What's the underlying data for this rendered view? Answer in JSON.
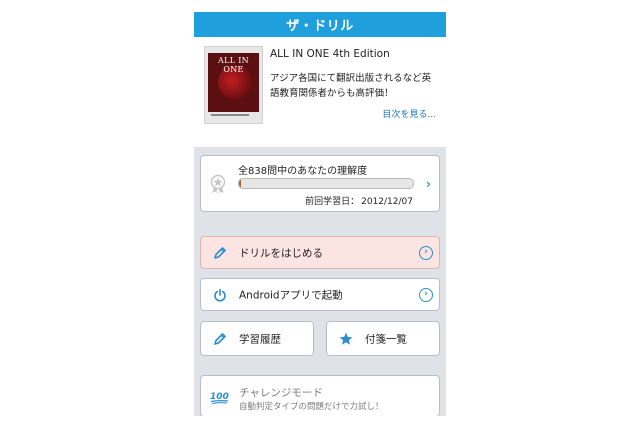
{
  "app": {
    "title": "ザ・ドリル"
  },
  "book": {
    "cover_title": "ALL IN ONE",
    "name": "ALL IN ONE 4th Edition",
    "description": "アジア各国にて翻訳出版されるなど英語教育関係者からも高評価！",
    "toc_link": "目次を見る..."
  },
  "progress": {
    "label": "全838問中のあなたの理解度",
    "fill": 0.01,
    "date_label": "前回学習日：",
    "date_value": "2012/12/07",
    "icon": "medal-icon"
  },
  "menu": {
    "start_label": "ドリルをはじめる",
    "android_label": "Androidアプリで起動",
    "history_label": "学習履歴",
    "sticky_label": "付箋一覧",
    "challenge_label": "チャレンジモード",
    "challenge_sub": "自動判定タイプの問題だけで力試し！"
  },
  "colors": {
    "title_bar": "#1fa0dc",
    "accent": "#2a8ed0",
    "start_bg": "#fbe4e1",
    "panel_bg": "#dfe3e8"
  }
}
